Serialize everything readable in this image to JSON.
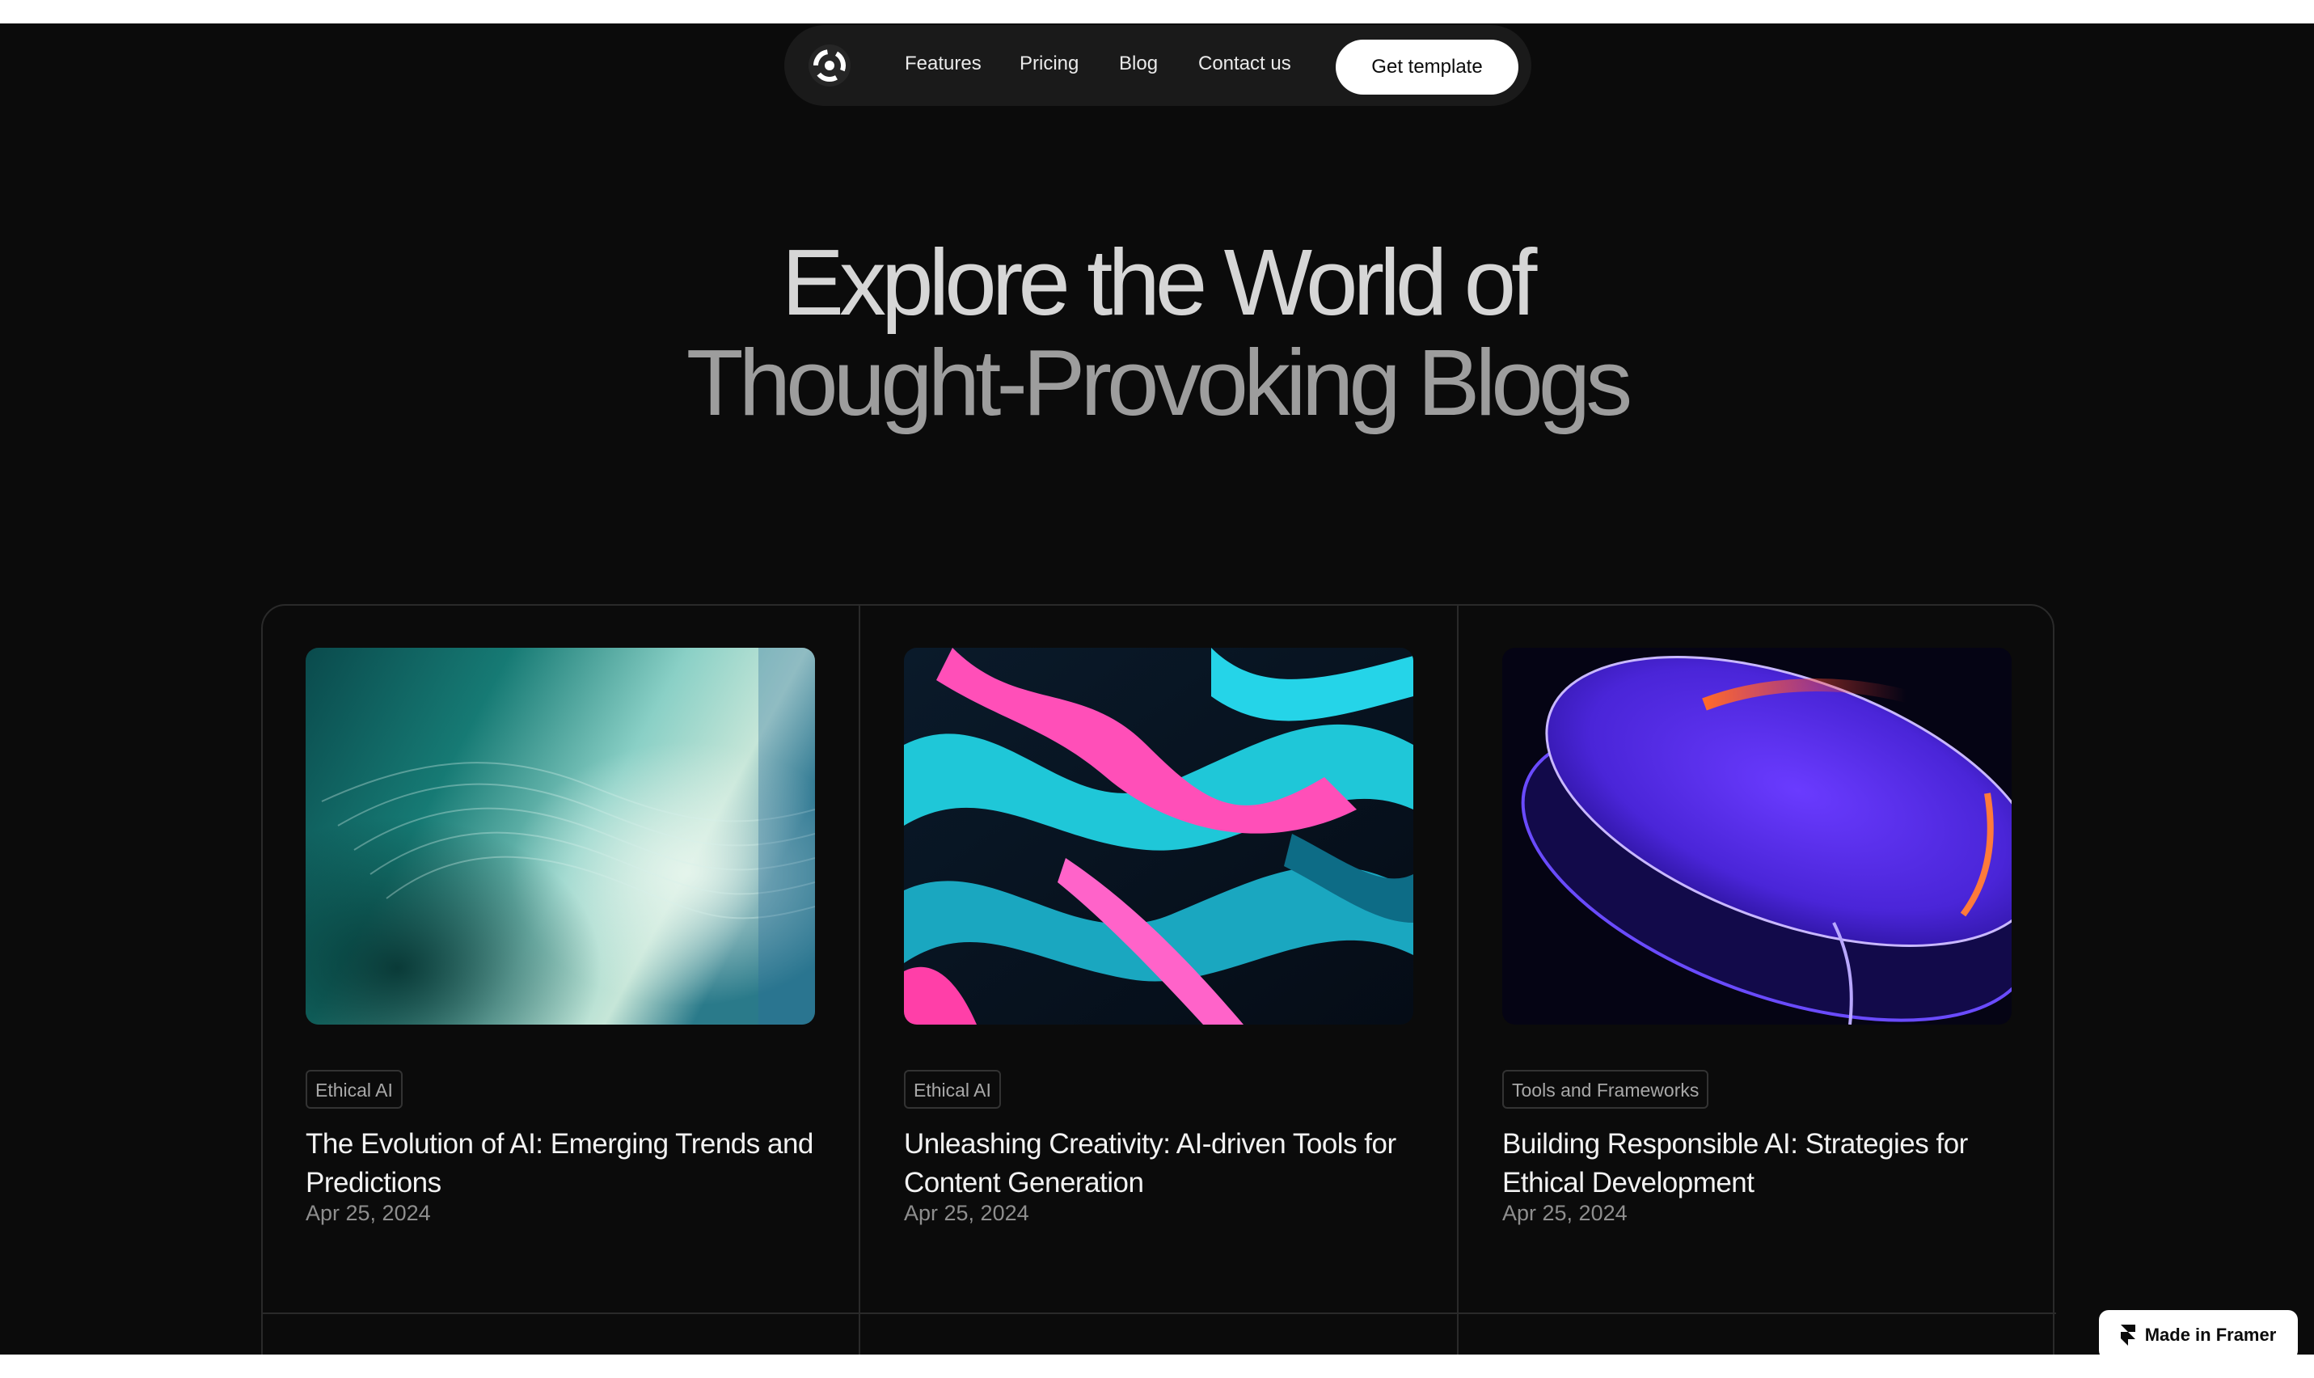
{
  "nav": {
    "links": [
      "Features",
      "Pricing",
      "Blog",
      "Contact us"
    ],
    "cta": "Get template"
  },
  "hero": {
    "line1": "Explore the World of",
    "line2": "Thought-Provoking Blogs"
  },
  "posts": [
    {
      "tag": "Ethical AI",
      "title": "The Evolution of AI: Emerging Trends and Predictions",
      "date": "Apr 25, 2024"
    },
    {
      "tag": "Ethical AI",
      "title": "Unleashing Creativity: AI-driven Tools for Content Generation",
      "date": "Apr 25, 2024"
    },
    {
      "tag": "Tools and Frameworks",
      "title": "Building Responsible AI: Strategies for Ethical Development",
      "date": "Apr 25, 2024"
    }
  ],
  "badge": {
    "label": "Made in Framer"
  },
  "colors": {
    "background": "#0b0b0b",
    "nav_bg": "#1a1a1a",
    "cta_bg": "#ffffff",
    "border": "#2a2a2a"
  }
}
